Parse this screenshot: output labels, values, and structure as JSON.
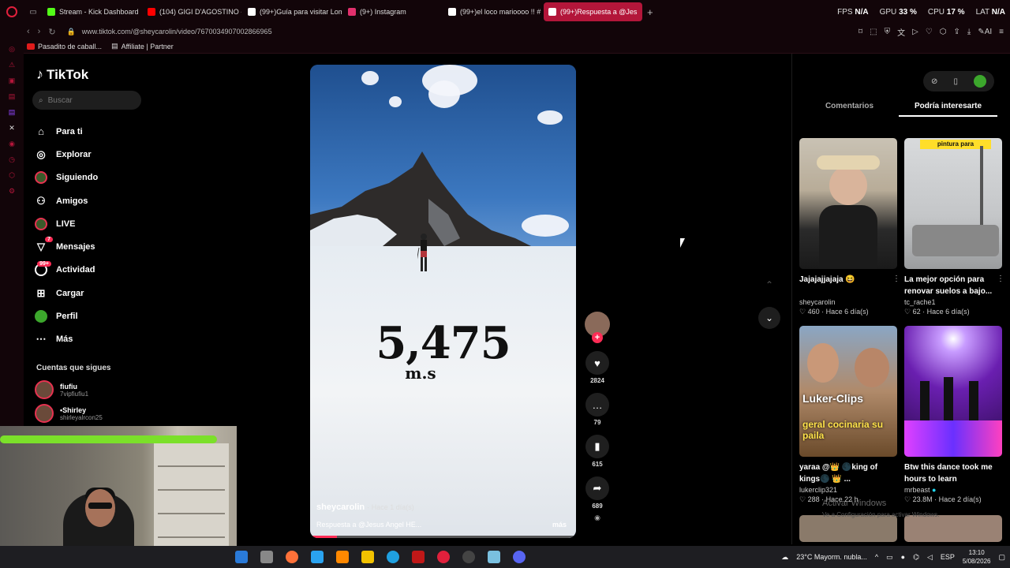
{
  "browser": {
    "tabs": [
      {
        "label": "Stream - Kick Dashboard",
        "color": "#53fc18"
      },
      {
        "label": "(104) GIGI D'AGOSTINO - I",
        "color": "#ff0000"
      },
      {
        "label": "(99+)Guía para visitar Lom",
        "color": "#ffffff"
      },
      {
        "label": "(9+) Instagram",
        "color": "#e1306c"
      },
      {
        "label": "(99+)el loco marioooo !! #",
        "color": "#ffffff"
      },
      {
        "label": "(99+)Respuesta a @Jes",
        "color": "#ffffff",
        "active": true
      }
    ],
    "url": "www.tiktok.com/@sheycarolin/video/7670034907002866965",
    "bookmarks": [
      {
        "label": "Pasadito de caball..."
      },
      {
        "label": "Affiliate | Partner"
      }
    ],
    "stats": {
      "fps_label": "FPS",
      "fps_value": "N/A",
      "gpu_label": "GPU",
      "gpu_value": "33 %",
      "cpu_label": "CPU",
      "cpu_value": "17 %",
      "lat_label": "LAT",
      "lat_value": "N/A"
    }
  },
  "tiktok": {
    "logo": "TikTok",
    "search_placeholder": "Buscar",
    "nav": [
      {
        "label": "Para ti",
        "icon": "home-icon"
      },
      {
        "label": "Explorar",
        "icon": "compass-icon"
      },
      {
        "label": "Siguiendo",
        "icon": "avatar-icon"
      },
      {
        "label": "Amigos",
        "icon": "friends-icon"
      },
      {
        "label": "LIVE",
        "icon": "live-icon"
      },
      {
        "label": "Mensajes",
        "icon": "message-icon",
        "badge": "7"
      },
      {
        "label": "Actividad",
        "icon": "activity-icon",
        "badge": "99+"
      },
      {
        "label": "Cargar",
        "icon": "upload-icon"
      },
      {
        "label": "Perfil",
        "icon": "profile-icon"
      },
      {
        "label": "Más",
        "icon": "more-icon"
      }
    ],
    "following_title": "Cuentas que sigues",
    "following": [
      {
        "name": "fiufiu",
        "user": "7vipfiufiu1"
      },
      {
        "name": "•Shirley",
        "user": "shirleyalrcon25"
      }
    ],
    "video": {
      "overlay_number": "5,475",
      "overlay_unit": "m.s",
      "author": "sheycarolin",
      "time": "· Hace 1 día(s)",
      "caption": "Respuesta a @Jesus Angel HE...",
      "more": "más",
      "progress": 0.1
    },
    "actions": {
      "likes": "2824",
      "comments": "79",
      "saves": "615",
      "shares": "689"
    },
    "right_tabs": [
      "Comentarios",
      "Podría interesarte"
    ],
    "cards": [
      {
        "title": "Jajajajjajaja 😆",
        "user": "sheycarolin",
        "likes": "460",
        "time": "· Hace 6 día(s)"
      },
      {
        "title": "La mejor opción para renovar suelos a bajo...",
        "user": "tc_rache1",
        "likes": "62",
        "time": "· Hace 6 día(s)",
        "tag": "pintura para"
      },
      {
        "title": "yaraa @👑 🌑king of kings🌑 👑 ...",
        "user": "lukerclip321",
        "likes": "288",
        "time": "· Hace 22 h",
        "overlay": "geral cocinaria su paila",
        "brand": "Luker-Clips"
      },
      {
        "title": "Btw this dance took me hours to learn",
        "user": "mrbeast",
        "likes": "23.8M",
        "time": "· Hace 2 día(s)"
      }
    ]
  },
  "watermark": {
    "line1": "Activar Windows",
    "line2": "Ve a Configuración para activar Windows."
  },
  "taskbar": {
    "weather": "23°C  Mayorm. nubla...",
    "lang": "ESP",
    "time": "13:10",
    "date": "5/08/2026"
  }
}
